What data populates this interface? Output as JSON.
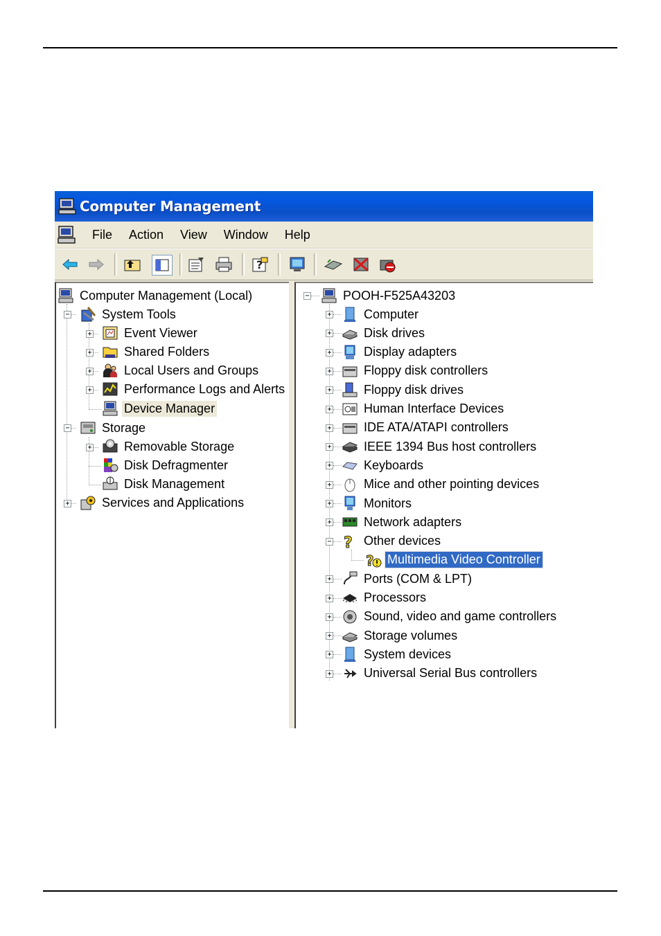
{
  "window": {
    "title": "Computer Management"
  },
  "menu": [
    "File",
    "Action",
    "View",
    "Window",
    "Help"
  ],
  "toolbar": {
    "buttons": [
      "back-icon",
      "forward-icon",
      "up-folder-icon",
      "show-hide-tree-icon",
      "properties-icon",
      "print-icon",
      "help-icon",
      "monitor-icon",
      "scan-hardware-icon",
      "uninstall-icon",
      "disable-icon"
    ]
  },
  "left_tree": {
    "root": "Computer Management (Local)",
    "system_tools": "System Tools",
    "event_viewer": "Event Viewer",
    "shared_folders": "Shared Folders",
    "local_users": "Local Users and Groups",
    "perf_logs": "Performance Logs and Alerts",
    "device_manager": "Device Manager",
    "storage": "Storage",
    "removable_storage": "Removable Storage",
    "disk_defrag": "Disk Defragmenter",
    "disk_management": "Disk Management",
    "services": "Services and Applications"
  },
  "right_tree": {
    "root": "POOH-F525A43203",
    "items": [
      "Computer",
      "Disk drives",
      "Display adapters",
      "Floppy disk controllers",
      "Floppy disk drives",
      "Human Interface Devices",
      "IDE ATA/ATAPI controllers",
      "IEEE 1394 Bus host controllers",
      "Keyboards",
      "Mice and other pointing devices",
      "Monitors",
      "Network adapters",
      "Other devices",
      "Multimedia Video Controller",
      "Ports (COM & LPT)",
      "Processors",
      "Sound, video and game controllers",
      "Storage volumes",
      "System devices",
      "Universal Serial Bus controllers"
    ]
  },
  "colors": {
    "titlebar": "#0a5fd8",
    "selection": "#316ac5",
    "chrome": "#ece9d8"
  }
}
